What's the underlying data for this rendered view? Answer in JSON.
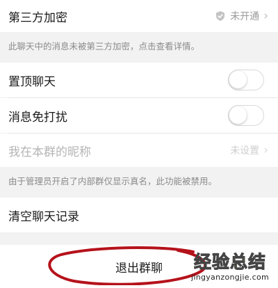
{
  "encryption": {
    "label": "第三方加密",
    "status": "未开通",
    "chevron": "›",
    "icon": "shield-icon",
    "note": "此聊天中的消息未被第三方加密，点击查看详情。"
  },
  "pin_chat": {
    "label": "置顶聊天",
    "enabled": false
  },
  "mute": {
    "label": "消息免打扰",
    "enabled": false
  },
  "group_nickname": {
    "label": "我在本群的昵称",
    "value": "未设置",
    "chevron": "›",
    "note": "由于管理员开启了内部群仅显示真名，此功能被禁用。"
  },
  "clear_history": {
    "label": "清空聊天记录"
  },
  "exit_group": {
    "label": "退出群聊"
  },
  "annotation": {
    "color": "#b5121b"
  },
  "watermark": {
    "title_a": "经验",
    "title_b": "总结",
    "url": "jingyanzongjie.com"
  }
}
